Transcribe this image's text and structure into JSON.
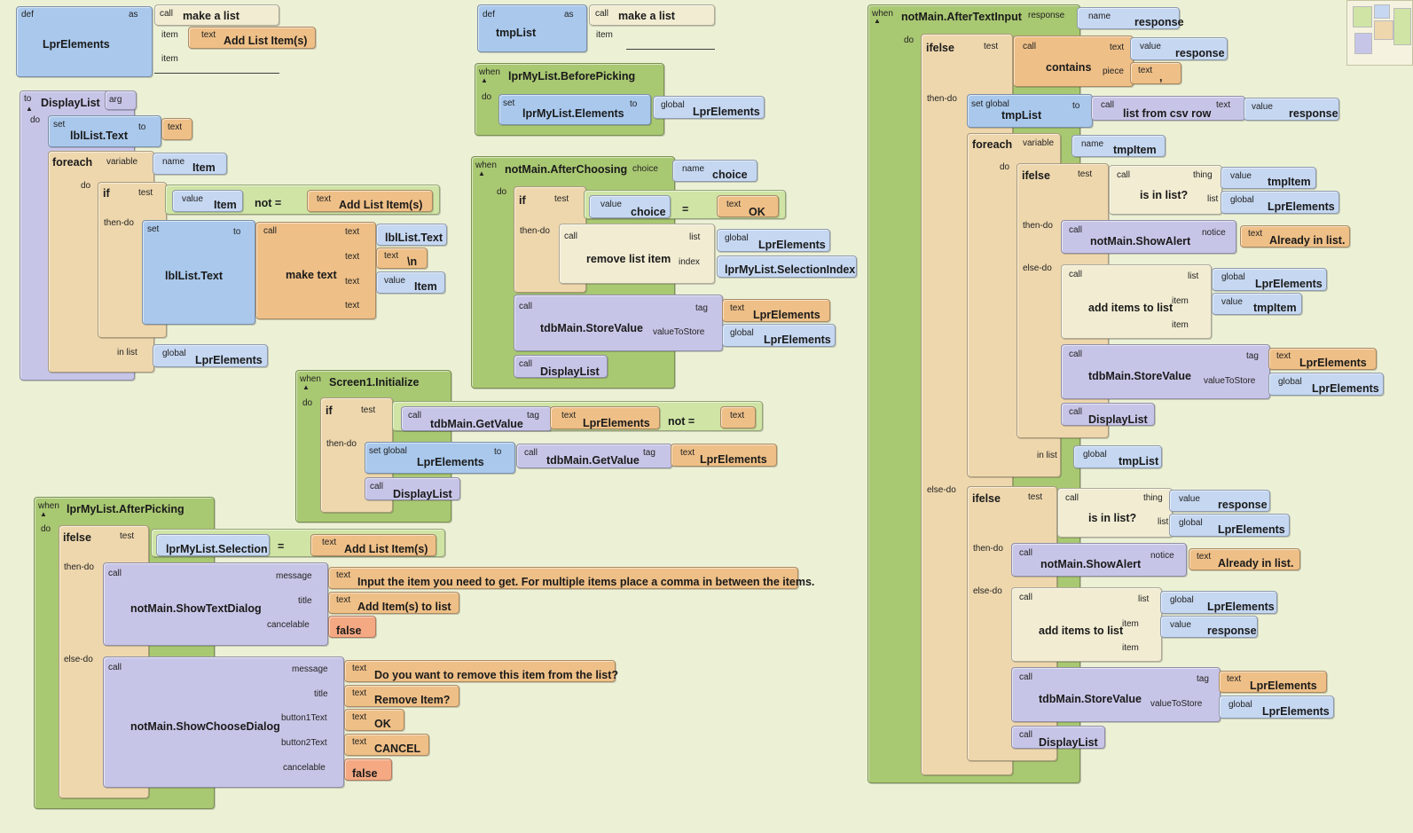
{
  "kw": {
    "def": "def",
    "as": "as",
    "call": "call",
    "item": "item",
    "text": "text",
    "to": "to",
    "arg": "arg",
    "do": "do",
    "set": "set",
    "foreach": "foreach",
    "variable": "variable",
    "name": "name",
    "if": "if",
    "test": "test",
    "value": "value",
    "then_do": "then-do",
    "else_do": "else-do",
    "in_list": "in list",
    "global": "global",
    "when": "when",
    "ifelse": "ifelse",
    "message": "message",
    "title": "title",
    "cancelable": "cancelable",
    "button1Text": "button1Text",
    "button2Text": "button2Text",
    "list": "list",
    "index": "index",
    "tag": "tag",
    "valueToStore": "valueToStore",
    "set_global": "set global",
    "choice": "choice",
    "response": "response",
    "piece": "piece",
    "thing": "thing",
    "notice": "notice",
    "eq": "=",
    "not_eq": "not =",
    "collapse": "▲"
  },
  "defLprElements": {
    "name": "LprElements",
    "call_name": "make a list",
    "item1_text": "Add List Item(s)"
  },
  "defTmpList": {
    "name": "tmpList",
    "call_name": "make a list"
  },
  "displayList": {
    "name": "DisplayList",
    "set_target": "lblList.Text",
    "foreach_var": "Item",
    "if_value": "Item",
    "if_compare_text": "Add List Item(s)",
    "set_inner": "lblList.Text",
    "make_text": "make text",
    "mt_1": "lblList.Text",
    "mt_2": "\\n",
    "mt_3": "Item",
    "in_list_global": "LprElements"
  },
  "beforePicking": {
    "event": "lprMyList.BeforePicking",
    "set_target": "lprMyList.Elements",
    "to_global": "LprElements"
  },
  "afterChoosing": {
    "event": "notMain.AfterChoosing",
    "param": "choice",
    "if_value": "choice",
    "if_text": "OK",
    "remove_call": "remove list item",
    "list_global": "LprElements",
    "index_val": "lprMyList.SelectionIndex",
    "store_call": "tdbMain.StoreValue",
    "tag_text": "LprElements",
    "vts_global": "LprElements",
    "display_call": "DisplayList"
  },
  "screenInit": {
    "event": "Screen1.Initialize",
    "get_call": "tdbMain.GetValue",
    "get_tag": "LprElements",
    "set_global_name": "LprElements",
    "get_call2": "tdbMain.GetValue",
    "get_tag2": "LprElements",
    "display_call": "DisplayList"
  },
  "afterPicking": {
    "event": "lprMyList.AfterPicking",
    "test_val": "lprMyList.Selection",
    "test_text": "Add List Item(s)",
    "dialog1": "notMain.ShowTextDialog",
    "msg1": "Input the item you need to get. For multiple items place a comma in between the items.",
    "title1": "Add Item(s) to list",
    "cancel1": "false",
    "dialog2": "notMain.ShowChooseDialog",
    "msg2": "Do you want to remove this item from the list?",
    "title2": "Remove Item?",
    "btn1": "OK",
    "btn2": "CANCEL",
    "cancel2": "false"
  },
  "afterTextInput": {
    "event": "notMain.AfterTextInput",
    "param": "response",
    "contains": "contains",
    "contains_val": "response",
    "contains_piece": ",",
    "set_tmp": "tmpList",
    "csv_call": "list from csv row",
    "csv_val": "response",
    "foreach_var": "tmpItem",
    "isin": "is in list?",
    "isin_thing": "tmpItem",
    "isin_list": "LprElements",
    "alert": "notMain.ShowAlert",
    "alert_text": "Already in list.",
    "add": "add items to list",
    "add_list": "LprElements",
    "add_item": "tmpItem",
    "store": "tdbMain.StoreValue",
    "store_tag": "LprElements",
    "store_vts": "LprElements",
    "display": "DisplayList",
    "in_list_global": "tmpList",
    "isin2": "is in list?",
    "isin2_thing": "response",
    "isin2_list": "LprElements",
    "alert2": "notMain.ShowAlert",
    "alert2_text": "Already in list.",
    "add2": "add items to list",
    "add2_list": "LprElements",
    "add2_item": "response",
    "store2": "tdbMain.StoreValue",
    "store2_tag": "LprElements",
    "store2_vts": "LprElements",
    "display2": "DisplayList"
  },
  "colors": {
    "canvas": "#ecf1d6",
    "event": "#a9c872",
    "variable": "#a9c8ec",
    "text": "#eebf87",
    "call": "#c7c5e7",
    "list": "#f1ecd2",
    "logic_false": "#f4a983"
  }
}
